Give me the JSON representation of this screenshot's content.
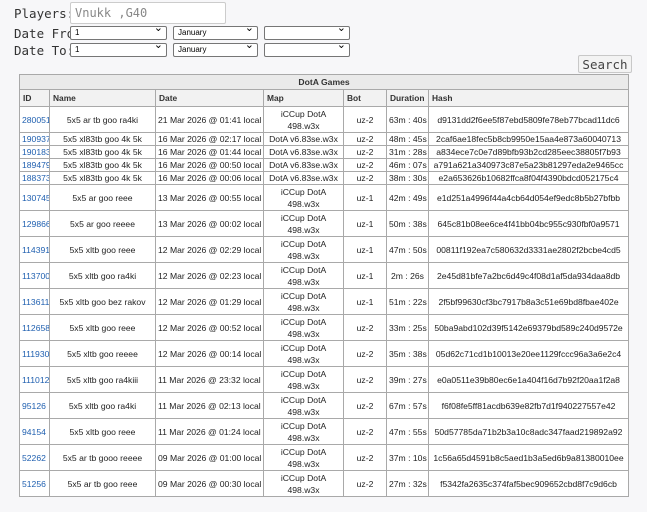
{
  "filters": {
    "players_label": "Players:",
    "players_value": "Vnukk ,G40",
    "date_from_label": "Date From:",
    "date_to_label": "Date To:",
    "from_day": "1",
    "from_month": "January",
    "from_year": "",
    "to_day": "1",
    "to_month": "January",
    "to_year": "",
    "search_label": "Search"
  },
  "table": {
    "caption": "DotA Games",
    "headers": [
      "ID",
      "Name",
      "Date",
      "Map",
      "Bot",
      "Duration",
      "Hash"
    ],
    "rows": [
      {
        "id": "280051",
        "name": "5x5 ar tb goo ra4ki",
        "date": "21 Mar 2026 @ 01:41 local",
        "map": "iCCup DotA 498.w3x",
        "bot": "uz-2",
        "duration": "63m : 40s",
        "hash": "d9131dd2f6ee5f87ebd5809fe78eb77bcad11dc6"
      },
      {
        "id": "190937",
        "name": "5x5 xl83tb goo 4k 5k",
        "date": "16 Mar 2026 @ 02:17 local",
        "map": "DotA v6.83se.w3x",
        "bot": "uz-2",
        "duration": "48m : 45s",
        "hash": "2caf6ae18fec5b8cb9950e15aa4e873a60040713"
      },
      {
        "id": "190183",
        "name": "5x5 xl83tb goo 4k 5k",
        "date": "16 Mar 2026 @ 01:44 local",
        "map": "DotA v6.83se.w3x",
        "bot": "uz-2",
        "duration": "31m : 28s",
        "hash": "a834ece7c0e7d89bfb93b2cd285eec38805f7b93"
      },
      {
        "id": "189479",
        "name": "5x5 xl83tb goo 4k 5k",
        "date": "16 Mar 2026 @ 00:50 local",
        "map": "DotA v6.83se.w3x",
        "bot": "uz-2",
        "duration": "46m : 07s",
        "hash": "a791a621a340973c87e5a23b81297eda2e9465cc"
      },
      {
        "id": "188373",
        "name": "5x5 xl83tb goo 4k 5k",
        "date": "16 Mar 2026 @ 00:06 local",
        "map": "DotA v6.83se.w3x",
        "bot": "uz-2",
        "duration": "38m : 30s",
        "hash": "e2a653626b10682ffca8f04f4390bdcd052175c4"
      },
      {
        "id": "130745",
        "name": "5x5 ar goo reee",
        "date": "13 Mar 2026 @ 00:55 local",
        "map": "iCCup DotA 498.w3x",
        "bot": "uz-1",
        "duration": "42m : 49s",
        "hash": "e1d251a4996f44a4cb64d054ef9edc8b5b27bfbb"
      },
      {
        "id": "129866",
        "name": "5x5 ar goo reeee",
        "date": "13 Mar 2026 @ 00:02 local",
        "map": "iCCup DotA 498.w3x",
        "bot": "uz-1",
        "duration": "50m : 38s",
        "hash": "645c81b08ee6ce4f41bb04bc955c930fbf0a9571"
      },
      {
        "id": "114391",
        "name": "5x5 xltb goo reee",
        "date": "12 Mar 2026 @ 02:29 local",
        "map": "iCCup DotA 498.w3x",
        "bot": "uz-1",
        "duration": "47m : 50s",
        "hash": "00811f192ea7c580632d3331ae2802f2bcbe4cd5"
      },
      {
        "id": "113700",
        "name": "5x5 xltb goo ra4ki",
        "date": "12 Mar 2026 @ 02:23 local",
        "map": "iCCup DotA 498.w3x",
        "bot": "uz-1",
        "duration": "2m : 26s",
        "hash": "2e45d81bfe7a2bc6d49c4f08d1af5da934daa8db"
      },
      {
        "id": "113611",
        "name": "5x5 xltb goo bez rakov",
        "date": "12 Mar 2026 @ 01:29 local",
        "map": "iCCup DotA 498.w3x",
        "bot": "uz-1",
        "duration": "51m : 22s",
        "hash": "2f5bf99630cf3bc7917b8a3c51e69bd8fbae402e"
      },
      {
        "id": "112658",
        "name": "5x5 xltb goo reee",
        "date": "12 Mar 2026 @ 00:52 local",
        "map": "iCCup DotA 498.w3x",
        "bot": "uz-2",
        "duration": "33m : 25s",
        "hash": "50ba9abd102d39f5142e69379bd589c240d9572e"
      },
      {
        "id": "111930",
        "name": "5x5 xltb goo reeee",
        "date": "12 Mar 2026 @ 00:14 local",
        "map": "iCCup DotA 498.w3x",
        "bot": "uz-2",
        "duration": "35m : 38s",
        "hash": "05d62c71cd1b10013e20ee1129fccc96a3a6e2c4"
      },
      {
        "id": "111012",
        "name": "5x5 xltb goo ra4kiii",
        "date": "11 Mar 2026 @ 23:32 local",
        "map": "iCCup DotA 498.w3x",
        "bot": "uz-2",
        "duration": "39m : 27s",
        "hash": "e0a0511e39b80ec6e1a404f16d7b92f20aa1f2a8"
      },
      {
        "id": "95126",
        "name": "5x5 xltb goo ra4ki",
        "date": "11 Mar 2026 @ 02:13 local",
        "map": "iCCup DotA 498.w3x",
        "bot": "uz-2",
        "duration": "67m : 57s",
        "hash": "f6f08fe5ff81acdb639e82fb7d1f940227557e42"
      },
      {
        "id": "94154",
        "name": "5x5 xltb goo reee",
        "date": "11 Mar 2026 @ 01:24 local",
        "map": "iCCup DotA 498.w3x",
        "bot": "uz-2",
        "duration": "47m : 55s",
        "hash": "50d57785da71b2b3a10c8adc347faad219892a92"
      },
      {
        "id": "52262",
        "name": "5x5 ar tb gooo reeee",
        "date": "09 Mar 2026 @ 01:00 local",
        "map": "iCCup DotA 498.w3x",
        "bot": "uz-2",
        "duration": "37m : 10s",
        "hash": "1c56a65d4591b8c5aed1b3a5ed6b9a81380010ee"
      },
      {
        "id": "51256",
        "name": "5x5 ar tb goo reee",
        "date": "09 Mar 2026 @ 00:30 local",
        "map": "iCCup DotA 498.w3x",
        "bot": "uz-2",
        "duration": "27m : 32s",
        "hash": "f5342fa2635c374faf5bec909652cbd8f7c9d6cb"
      }
    ]
  }
}
